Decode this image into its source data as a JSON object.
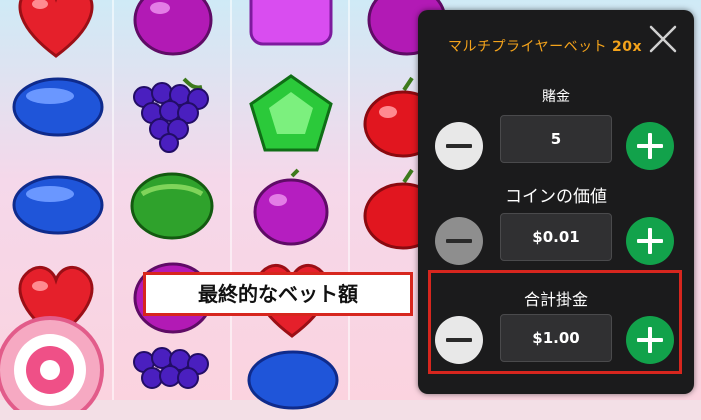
{
  "panel": {
    "title": "マルチプライヤーベット",
    "multiplier": "20x",
    "bet_label": "賭金",
    "bet_value": "5",
    "coin_label": "コインの価値",
    "coin_value": "$0.01",
    "total_label": "合計掛金",
    "total_value": "$1.00"
  },
  "annotation": {
    "callout_text": "最終的なベット額"
  },
  "colors": {
    "title": "#f4a31b",
    "plus": "#12a24b",
    "highlight": "#d7261e"
  },
  "symbols": [
    "red-heart",
    "purple-plum",
    "purple-square-candy",
    "red-apple",
    "blue-oval-candy",
    "grape-bunch",
    "green-pentagon-candy",
    "watermelon",
    "plum",
    "swirl-lollipop"
  ]
}
